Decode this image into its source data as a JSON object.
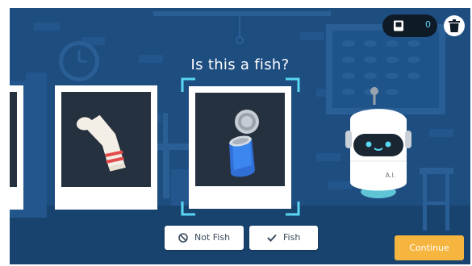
{
  "title": "Is this a fish?",
  "counter": {
    "value": "0",
    "icon": "book-icon"
  },
  "buttons": {
    "not_fish": "Not Fish",
    "fish": "Fish",
    "continue": "Continue"
  },
  "robot": {
    "label": "A.I."
  },
  "cards": [
    "partial-card",
    "sock-card",
    "tin-can-card"
  ],
  "colors": {
    "background": "#1e4d80",
    "accent": "#59d7f3",
    "continue": "#f6b53f",
    "card_image_bg": "#26313f"
  }
}
